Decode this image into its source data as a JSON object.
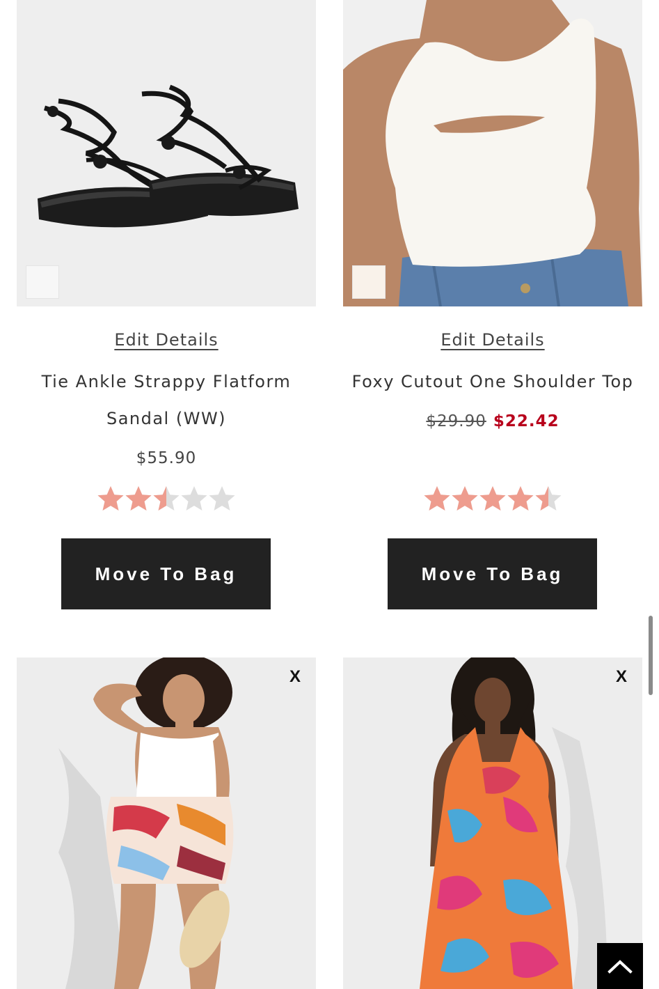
{
  "products": [
    {
      "edit_label": "Edit Details",
      "name": "Tie Ankle Strappy Flatform Sandal (WW)",
      "price": "$55.90",
      "rating": 2.5,
      "button_label": "Move To Bag",
      "image_icon": "sandal-image"
    },
    {
      "edit_label": "Edit Details",
      "name": "Foxy Cutout One Shoulder Top",
      "original_price": "$29.90",
      "sale_price": "$22.42",
      "rating": 4.5,
      "button_label": "Move To Bag",
      "image_icon": "top-image"
    },
    {
      "remove_label": "X",
      "image_icon": "shorts-image"
    },
    {
      "remove_label": "X",
      "image_icon": "dress-image"
    }
  ],
  "colors": {
    "star_filled": "#ee9c8e",
    "star_empty": "#dddddd",
    "button_bg": "#222222",
    "sale_price": "#b8001c"
  },
  "back_to_top_icon": "chevron-up-icon"
}
